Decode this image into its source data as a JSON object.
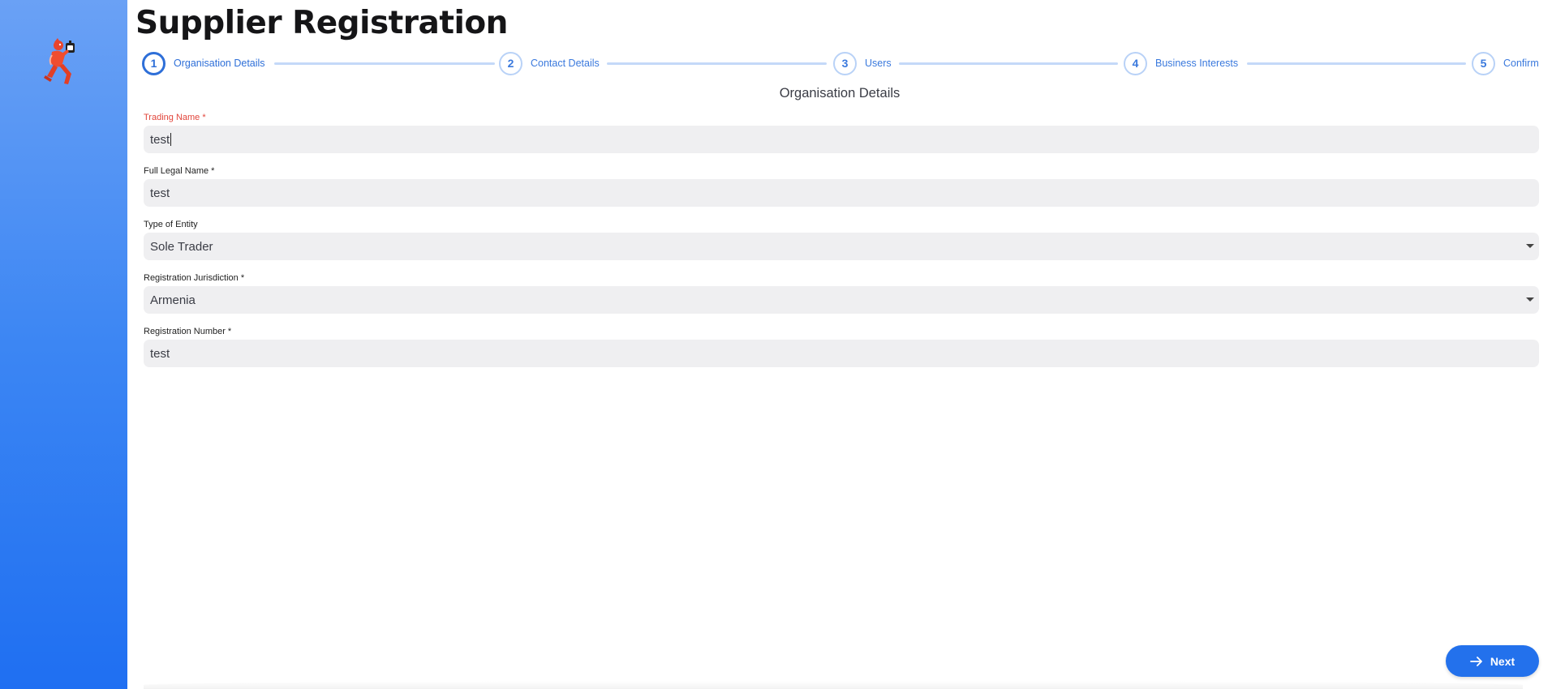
{
  "page": {
    "title": "Supplier Registration",
    "section_title": "Organisation Details"
  },
  "colors": {
    "sidebar_top": "#6aa1f5",
    "sidebar_bottom": "#1f6ff2",
    "accent": "#2e6fd8",
    "error": "#e2463c",
    "button": "#2371ec"
  },
  "stepper": {
    "steps": [
      {
        "number": "1",
        "label": "Organisation Details",
        "active": true
      },
      {
        "number": "2",
        "label": "Contact Details",
        "active": false
      },
      {
        "number": "3",
        "label": "Users",
        "active": false
      },
      {
        "number": "4",
        "label": "Business Interests",
        "active": false
      },
      {
        "number": "5",
        "label": "Confirm",
        "active": false
      }
    ]
  },
  "form": {
    "trading_name": {
      "label": "Trading Name *",
      "value": "test"
    },
    "full_legal_name": {
      "label": "Full Legal Name *",
      "value": "test"
    },
    "entity_type": {
      "label": "Type of Entity",
      "value": "Sole Trader"
    },
    "jurisdiction": {
      "label": "Registration Jurisdiction *",
      "value": "Armenia"
    },
    "registration_number": {
      "label": "Registration Number *",
      "value": "test"
    }
  },
  "actions": {
    "next_label": "Next",
    "next_icon": "arrow-right-icon"
  },
  "logo": {
    "icon": "running-mascot-logo"
  }
}
